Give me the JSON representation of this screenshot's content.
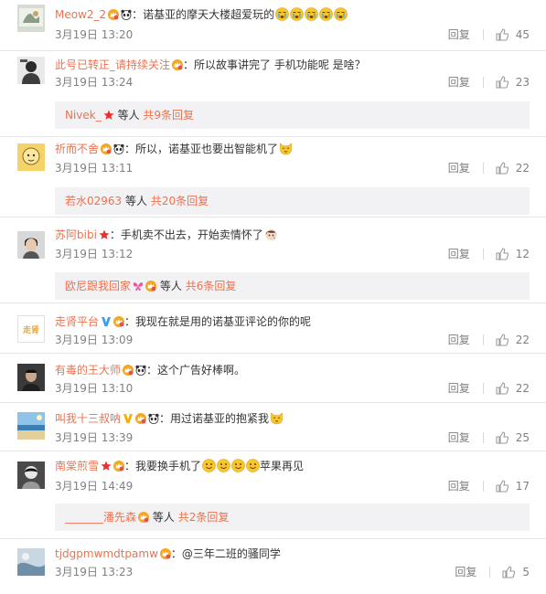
{
  "comments": [
    {
      "user": "Meow2_2",
      "text": "：诺基亚的摩天大楼超爱玩的",
      "time": "3月19日 13:20",
      "reply": "回复",
      "likes": "45"
    },
    {
      "user": "此号已转正_请持续关注",
      "text": "：所以故事讲完了 手机功能呢 是啥？",
      "time": "3月19日 13:24",
      "reply": "回复",
      "likes": "23",
      "sub": {
        "who": "Nivek_",
        "deng": "等人",
        "more": "共9条回复"
      }
    },
    {
      "user": "祈而不舍",
      "text": "：所以，诺基亚也要出智能机了",
      "time": "3月19日 13:11",
      "reply": "回复",
      "likes": "22",
      "sub": {
        "who": "若水02963",
        "deng": "等人",
        "more": "共20条回复"
      }
    },
    {
      "user": "苏阿bibi",
      "text": "：手机卖不出去，开始卖情怀了",
      "time": "3月19日 13:12",
      "reply": "回复",
      "likes": "12",
      "sub": {
        "who": "欧尼跟我回家",
        "deng": "等人",
        "more": "共6条回复"
      }
    },
    {
      "user": "走肾平台",
      "text": "：我现在就是用的诺基亚评论的你的呢",
      "time": "3月19日 13:09",
      "reply": "回复",
      "likes": "22",
      "avatar_text": "走肾"
    },
    {
      "user": "有毒的王大师",
      "text": "：这个广告好棒啊。",
      "time": "3月19日 13:10",
      "reply": "回复",
      "likes": "22"
    },
    {
      "user": "叫我十三叔呐",
      "text": "：用过诺基亚的抱紧我",
      "time": "3月19日 13:39",
      "reply": "回复",
      "likes": "25"
    },
    {
      "user": "南棠煎雪",
      "text": "：我要换手机了",
      "text2": "苹果再见",
      "time": "3月19日 14:49",
      "reply": "回复",
      "likes": "17",
      "sub": {
        "who": "_______潘先森",
        "deng": "等人",
        "more": "共2条回复"
      }
    },
    {
      "user": "tjdgpmwmdtpamw",
      "text": "：@三年二班的骚同学",
      "time": "3月19日 13:23",
      "reply": "回复",
      "likes": "5"
    }
  ],
  "colors": {
    "username": "#eb7350",
    "meta": "#808080",
    "subreply_bg": "#f2f2f5"
  }
}
